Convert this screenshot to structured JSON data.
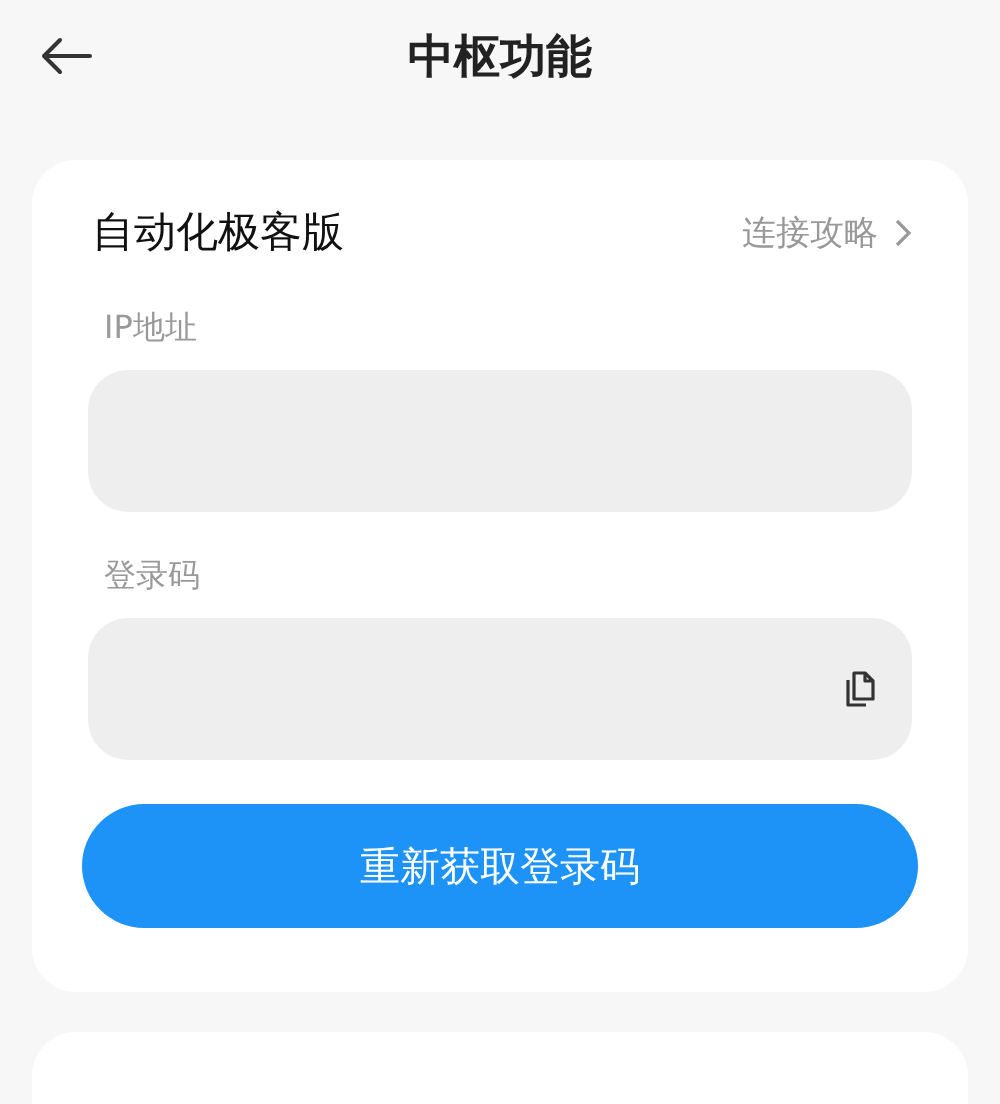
{
  "header": {
    "title": "中枢功能"
  },
  "card": {
    "title": "自动化极客版",
    "link": "连接攻略",
    "fields": [
      {
        "label": "IP地址",
        "kind": "plain"
      },
      {
        "label": "登录码",
        "kind": "copy"
      }
    ],
    "button": "重新获取登录码"
  }
}
